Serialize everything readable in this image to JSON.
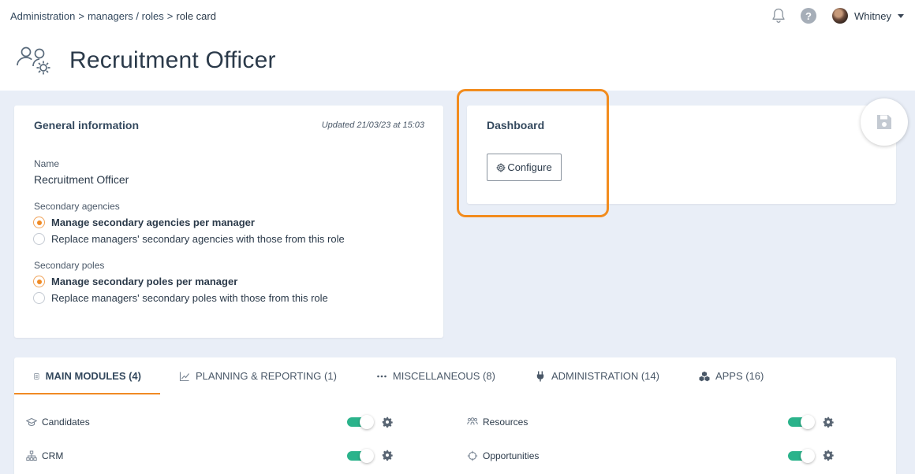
{
  "breadcrumb": {
    "items": [
      "Administration",
      "managers / roles"
    ],
    "current": "role card",
    "separator": ">"
  },
  "user": {
    "name": "Whitney"
  },
  "page": {
    "title": "Recruitment Officer"
  },
  "general": {
    "title": "General information",
    "updated": "Updated 21/03/23 at 15:03",
    "name_label": "Name",
    "name_value": "Recruitment Officer",
    "agencies_label": "Secondary agencies",
    "agencies_options": [
      "Manage secondary agencies per manager",
      "Replace managers' secondary agencies with those from this role"
    ],
    "agencies_selected": 0,
    "poles_label": "Secondary poles",
    "poles_options": [
      "Manage secondary poles per manager",
      "Replace managers' secondary poles with those from this role"
    ],
    "poles_selected": 0
  },
  "dashboard": {
    "title": "Dashboard",
    "configure_label": "Configure"
  },
  "tabs": [
    {
      "label": "MAIN MODULES (4)",
      "icon": "document-icon",
      "active": true
    },
    {
      "label": "PLANNING & REPORTING (1)",
      "icon": "chart-line-icon",
      "active": false
    },
    {
      "label": "MISCELLANEOUS (8)",
      "icon": "dots-icon",
      "active": false
    },
    {
      "label": "ADMINISTRATION (14)",
      "icon": "plug-icon",
      "active": false
    },
    {
      "label": "APPS (16)",
      "icon": "cubes-icon",
      "active": false
    }
  ],
  "modules": [
    {
      "label": "Candidates",
      "icon": "graduation-cap-icon",
      "enabled": true
    },
    {
      "label": "Resources",
      "icon": "people-icon",
      "enabled": true
    },
    {
      "label": "CRM",
      "icon": "sitemap-icon",
      "enabled": true
    },
    {
      "label": "Opportunities",
      "icon": "crosshair-icon",
      "enabled": true
    }
  ],
  "colors": {
    "accent": "#f08a24",
    "toggle_on": "#2bb38b",
    "highlight": "#f28c1e",
    "page_bg": "#e9eef7"
  }
}
